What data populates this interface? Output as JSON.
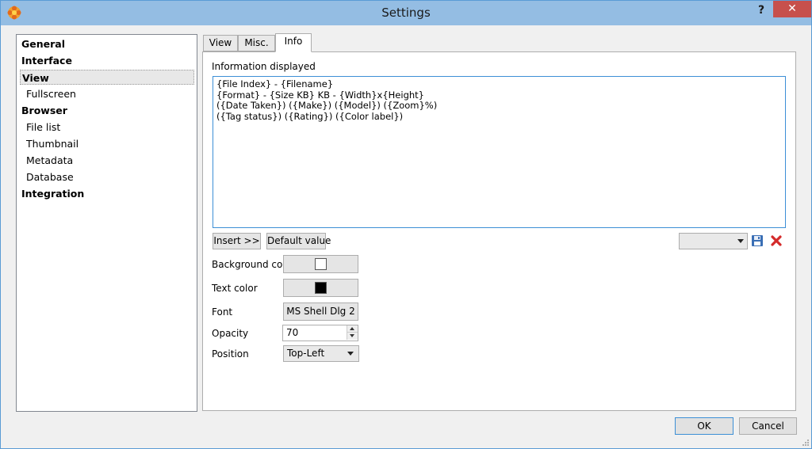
{
  "window": {
    "title": "Settings",
    "help": "?",
    "close": "✕"
  },
  "nav": {
    "items": [
      {
        "label": "General",
        "level": "cat"
      },
      {
        "label": "Interface",
        "level": "cat"
      },
      {
        "label": "View",
        "level": "cat",
        "selected": true
      },
      {
        "label": "Fullscreen",
        "level": "sub"
      },
      {
        "label": "Browser",
        "level": "cat"
      },
      {
        "label": "File list",
        "level": "sub"
      },
      {
        "label": "Thumbnail",
        "level": "sub"
      },
      {
        "label": "Metadata",
        "level": "sub"
      },
      {
        "label": "Database",
        "level": "sub"
      },
      {
        "label": "Integration",
        "level": "cat"
      }
    ]
  },
  "tabs": [
    {
      "label": "View",
      "active": false
    },
    {
      "label": "Misc.",
      "active": false
    },
    {
      "label": "Info",
      "active": true
    }
  ],
  "info": {
    "label": "Information displayed",
    "text": "{File Index} - {Filename}\n{Format} - {Size KB} KB - {Width}x{Height}\n({Date Taken}) ({Make}) ({Model}) ({Zoom}%)\n({Tag status}) ({Rating}) ({Color label})",
    "insert_label": "Insert >>",
    "default_label": "Default value",
    "preset_value": ""
  },
  "settings": {
    "background_color_label": "Background color",
    "background_color": "#ffffff",
    "text_color_label": "Text color",
    "text_color": "#000000",
    "font_label": "Font",
    "font_value": "MS Shell Dlg 2",
    "opacity_label": "Opacity",
    "opacity_value": "70",
    "position_label": "Position",
    "position_value": "Top-Left"
  },
  "footer": {
    "ok_label": "OK",
    "cancel_label": "Cancel"
  },
  "icons": {
    "app": "app-flower-icon",
    "save": "floppy-disk-icon",
    "delete": "red-x-icon"
  }
}
